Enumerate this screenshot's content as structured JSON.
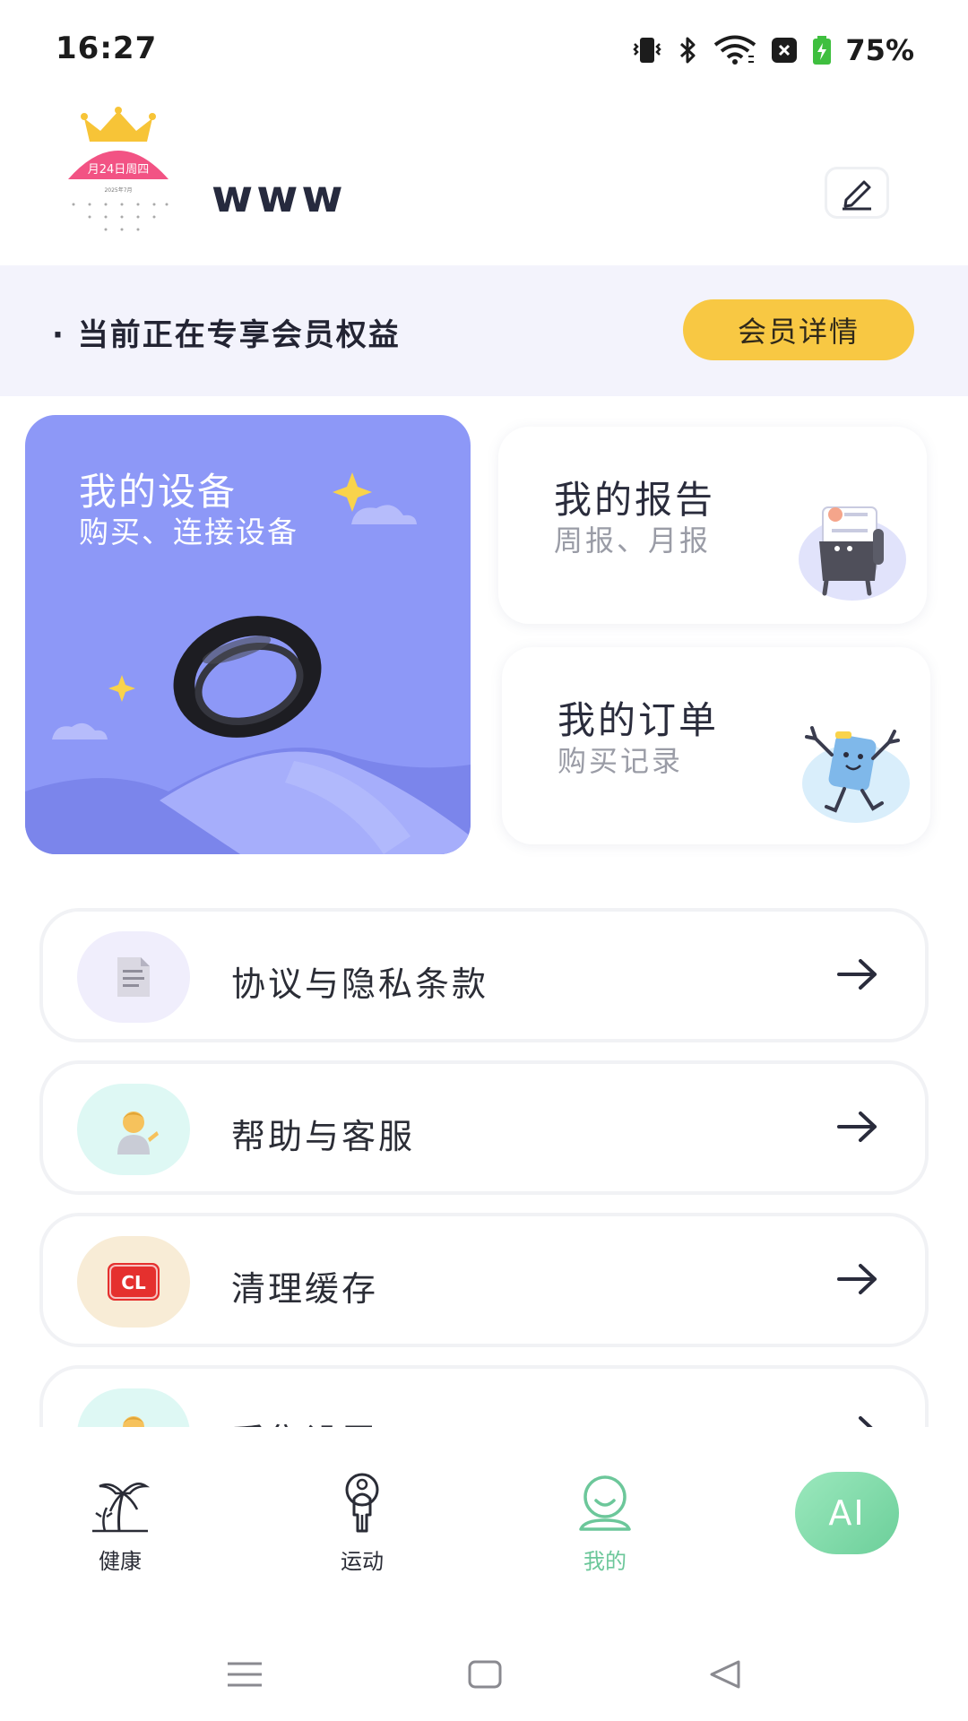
{
  "status_bar": {
    "time": "16:27",
    "battery": "75%",
    "icons": [
      "vibrate-icon",
      "bluetooth-icon",
      "wifi-icon",
      "notification-icon",
      "battery-icon"
    ]
  },
  "profile": {
    "username": "www",
    "avatar": {
      "date_text": "月24日周四",
      "month_text": "2025年7月"
    }
  },
  "member_banner": {
    "text": "· 当前正在专享会员权益",
    "button_label": "会员详情"
  },
  "cards": {
    "device": {
      "title": "我的设备",
      "subtitle": "购买、连接设备"
    },
    "report": {
      "title": "我的报告",
      "subtitle": "周报、月报"
    },
    "order": {
      "title": "我的订单",
      "subtitle": "购买记录"
    }
  },
  "menu": [
    {
      "label": "协议与隐私条款",
      "icon": "document-icon",
      "icon_bg": "#f0eefc"
    },
    {
      "label": "帮助与客服",
      "icon": "person-tipping-hand-icon",
      "icon_bg": "#def8f4"
    },
    {
      "label": "清理缓存",
      "icon": "cl-button-icon",
      "icon_bg": "#f8ecd6"
    },
    {
      "label": "采集设置",
      "icon": "person-icon",
      "icon_bg": "#def8f4"
    }
  ],
  "tabs": [
    {
      "label": "健康",
      "icon": "palm-tree-icon"
    },
    {
      "label": "运动",
      "icon": "person-outline-icon"
    },
    {
      "label": "我的",
      "icon": "smiley-person-icon",
      "active": true
    }
  ],
  "ai_button": {
    "label": "AI"
  },
  "colors": {
    "accent_green": "#6cc79a",
    "member_yellow": "#f8c843",
    "device_card": "#8d98f7",
    "banner_bg": "#f3f3fc"
  }
}
